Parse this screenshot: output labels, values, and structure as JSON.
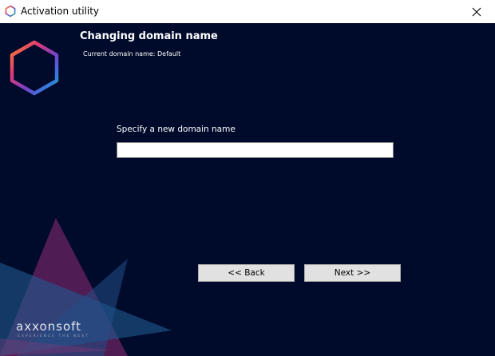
{
  "window": {
    "title": "Activation utility",
    "close_glyph": "✕"
  },
  "header": {
    "heading": "Changing domain name",
    "subheading": "Current domain name: Default"
  },
  "form": {
    "label": "Specify a new domain name",
    "input_value": ""
  },
  "buttons": {
    "back_label": "<< Back",
    "next_label": "Next >>"
  },
  "branding": {
    "name": "axxonsoft",
    "tagline": "EXPERIENCE THE NEXT"
  },
  "colors": {
    "background": "#000a2b",
    "button_face": "#e1e1e1",
    "text": "#ffffff"
  },
  "icons": {
    "app": "hexagon-logo-icon",
    "close": "close-icon"
  }
}
